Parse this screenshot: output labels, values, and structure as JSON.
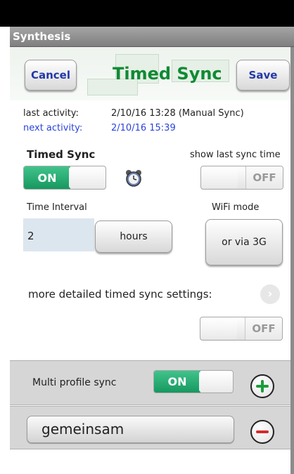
{
  "app": {
    "title": "Synthesis"
  },
  "header": {
    "cancel_label": "Cancel",
    "title": "Timed Sync",
    "save_label": "Save"
  },
  "activity": {
    "last_label": "last activity:",
    "last_value": "2/10/16  13:28  (Manual Sync)",
    "next_label": "next activity:",
    "next_value": "2/10/16  15:39"
  },
  "timed_sync": {
    "label": "Timed Sync",
    "toggle_on": "ON",
    "alarm_icon": "alarm-clock-icon"
  },
  "show_last_sync": {
    "label": "show last sync time",
    "toggle_off": "OFF"
  },
  "time_interval": {
    "label": "Time Interval",
    "value": "2",
    "unit_label": "hours"
  },
  "wifi_mode": {
    "label": "WiFi mode",
    "button_label": "or via 3G"
  },
  "detailed": {
    "label": "more detailed timed sync settings:",
    "toggle_off": "OFF",
    "icon": "chevron-right-icon"
  },
  "multi_profile": {
    "label": "Multi profile sync",
    "toggle_on": "ON",
    "add_icon": "plus-circle-icon"
  },
  "profile": {
    "name": "gemeinsam",
    "remove_icon": "minus-circle-icon"
  },
  "colors": {
    "accent_green": "#0f8a34",
    "toggle_on": "#1fa56b",
    "link_blue": "#2b44d9",
    "button_blue": "#2338a8"
  }
}
